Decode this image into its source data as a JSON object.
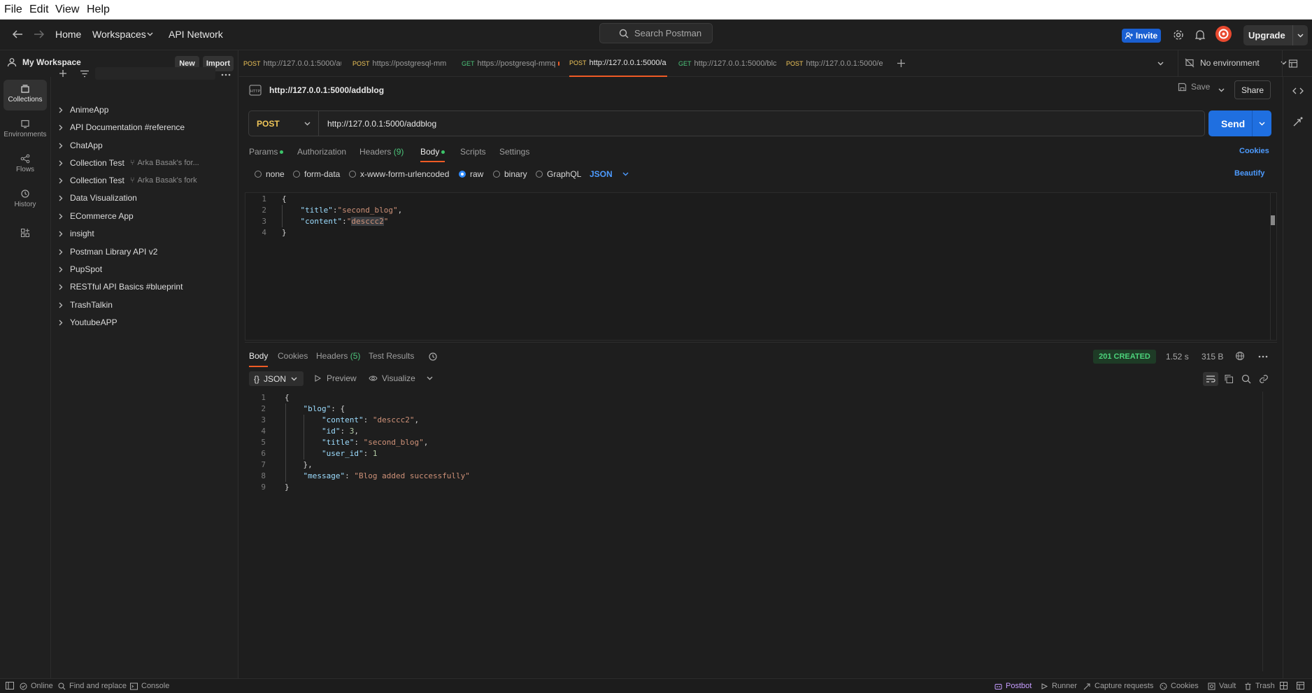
{
  "menubar": {
    "items": [
      "File",
      "Edit",
      "View",
      "Help"
    ]
  },
  "header": {
    "home": "Home",
    "workspaces": "Workspaces",
    "api_network": "API Network",
    "search_placeholder": "Search Postman",
    "invite": "Invite",
    "upgrade": "Upgrade"
  },
  "sidebar": {
    "workspace": "My Workspace",
    "new_btn": "New",
    "import_btn": "Import",
    "rail": [
      "Collections",
      "Environments",
      "Flows",
      "History"
    ],
    "collections": [
      {
        "name": "AnimeApp",
        "fork": ""
      },
      {
        "name": "API Documentation #reference",
        "fork": ""
      },
      {
        "name": "ChatApp",
        "fork": ""
      },
      {
        "name": "Collection Test",
        "fork": "Arka Basak's for..."
      },
      {
        "name": "Collection Test",
        "fork": "Arka Basak's fork"
      },
      {
        "name": "Data Visualization",
        "fork": ""
      },
      {
        "name": "ECommerce App",
        "fork": ""
      },
      {
        "name": "insight",
        "fork": ""
      },
      {
        "name": "Postman Library API v2",
        "fork": ""
      },
      {
        "name": "PupSpot",
        "fork": ""
      },
      {
        "name": "RESTful API Basics #blueprint",
        "fork": ""
      },
      {
        "name": "TrashTalkin",
        "fork": ""
      },
      {
        "name": "YoutubeAPP",
        "fork": ""
      }
    ]
  },
  "tabs": [
    {
      "method": "POST",
      "url": "http://127.0.0.1:5000/au",
      "method_color": "#f0c659"
    },
    {
      "method": "POST",
      "url": "https://postgresql-mm",
      "method_color": "#f0c659"
    },
    {
      "method": "GET",
      "url": "https://postgresql-mmq",
      "method_color": "#4cc47a"
    },
    {
      "method": "POST",
      "url": "http://127.0.0.1:5000/a",
      "method_color": "#f0c659"
    },
    {
      "method": "GET",
      "url": "http://127.0.0.1:5000/blc",
      "method_color": "#4cc47a"
    },
    {
      "method": "POST",
      "url": "http://127.0.0.1:5000/e",
      "method_color": "#f0c659"
    }
  ],
  "environment": "No environment",
  "request": {
    "title": "http://127.0.0.1:5000/addblog",
    "save": "Save",
    "share": "Share",
    "method": "POST",
    "url": "http://127.0.0.1:5000/addblog",
    "send": "Send",
    "subtabs": {
      "params": "Params",
      "authorization": "Authorization",
      "headers": "Headers",
      "headers_count": "(9)",
      "body": "Body",
      "scripts": "Scripts",
      "settings": "Settings",
      "cookies": "Cookies"
    },
    "body_types": [
      "none",
      "form-data",
      "x-www-form-urlencoded",
      "raw",
      "binary",
      "GraphQL"
    ],
    "body_format": "JSON",
    "beautify": "Beautify",
    "line_numbers": [
      "1",
      "2",
      "3",
      "4"
    ]
  },
  "response": {
    "tabs": {
      "body": "Body",
      "cookies": "Cookies",
      "headers": "Headers",
      "headers_count": "(5)",
      "test_results": "Test Results"
    },
    "status": "201 CREATED",
    "time": "1.52 s",
    "size": "315 B",
    "format": "JSON",
    "preview": "Preview",
    "visualize": "Visualize",
    "line_numbers": [
      "1",
      "2",
      "3",
      "4",
      "5",
      "6",
      "7",
      "8",
      "9"
    ]
  },
  "footer": {
    "online": "Online",
    "find_replace": "Find and replace",
    "console": "Console",
    "postbot": "Postbot",
    "runner": "Runner",
    "capture": "Capture requests",
    "cookies": "Cookies",
    "vault": "Vault",
    "trash": "Trash"
  }
}
